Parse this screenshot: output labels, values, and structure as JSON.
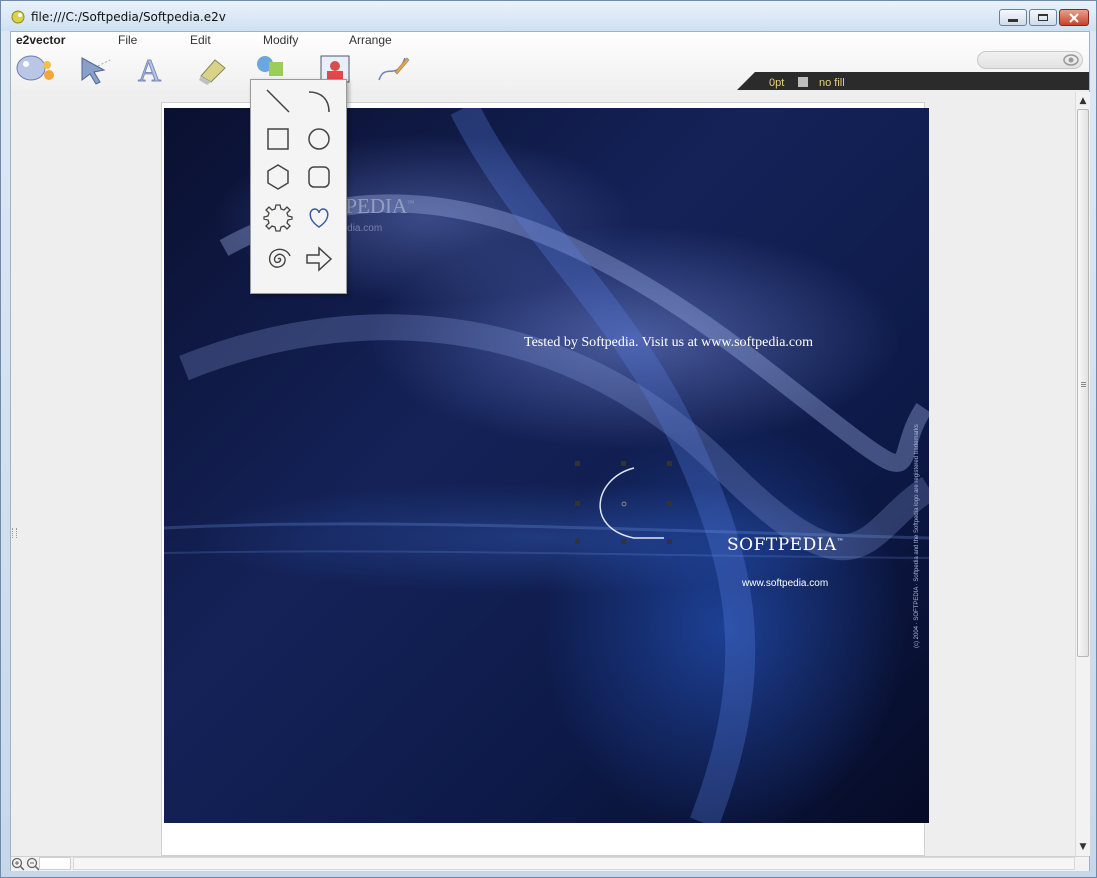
{
  "window": {
    "title": "file:///C:/Softpedia/Softpedia.e2v"
  },
  "menubar": {
    "brand": "e2vector",
    "items": [
      {
        "label": "File"
      },
      {
        "label": "Edit"
      },
      {
        "label": "Modify"
      },
      {
        "label": "Arrange"
      }
    ]
  },
  "toolbar": {
    "tools": [
      {
        "name": "palette-icon"
      },
      {
        "name": "select-arrow-icon"
      },
      {
        "name": "text-tool-icon"
      },
      {
        "name": "eraser-icon"
      },
      {
        "name": "shapes-icon"
      },
      {
        "name": "image-icon"
      },
      {
        "name": "pen-tool-icon"
      }
    ]
  },
  "search": {
    "value": "",
    "placeholder": ""
  },
  "properties": {
    "stroke": "0pt",
    "fill": "no fill",
    "label_color": "#e9d37a"
  },
  "shape_menu": {
    "items": [
      {
        "name": "line-icon"
      },
      {
        "name": "arc-icon"
      },
      {
        "name": "rectangle-icon"
      },
      {
        "name": "circle-icon"
      },
      {
        "name": "hexagon-icon"
      },
      {
        "name": "rounded-rectangle-icon"
      },
      {
        "name": "gear-icon"
      },
      {
        "name": "heart-icon"
      },
      {
        "name": "spiral-icon"
      },
      {
        "name": "arrow-right-icon"
      }
    ]
  },
  "artwork": {
    "tested_text": "Tested by Softpedia. Visit us at www.softpedia.com",
    "logo": "SOFTPEDIA",
    "trademark": "™",
    "url": "www.softpedia.com",
    "copyright": "(c) 2004 · SOFTPEDIA · Softpedia and the Softpedia logo are registered trademarks",
    "watermark": "SOFTPEDIA",
    "watermark_tm": "™",
    "watermark_url": "www.softpedia.com"
  },
  "colors": {
    "accent": "#3c82e6",
    "statusbar_bg": "#2b2b2b"
  }
}
